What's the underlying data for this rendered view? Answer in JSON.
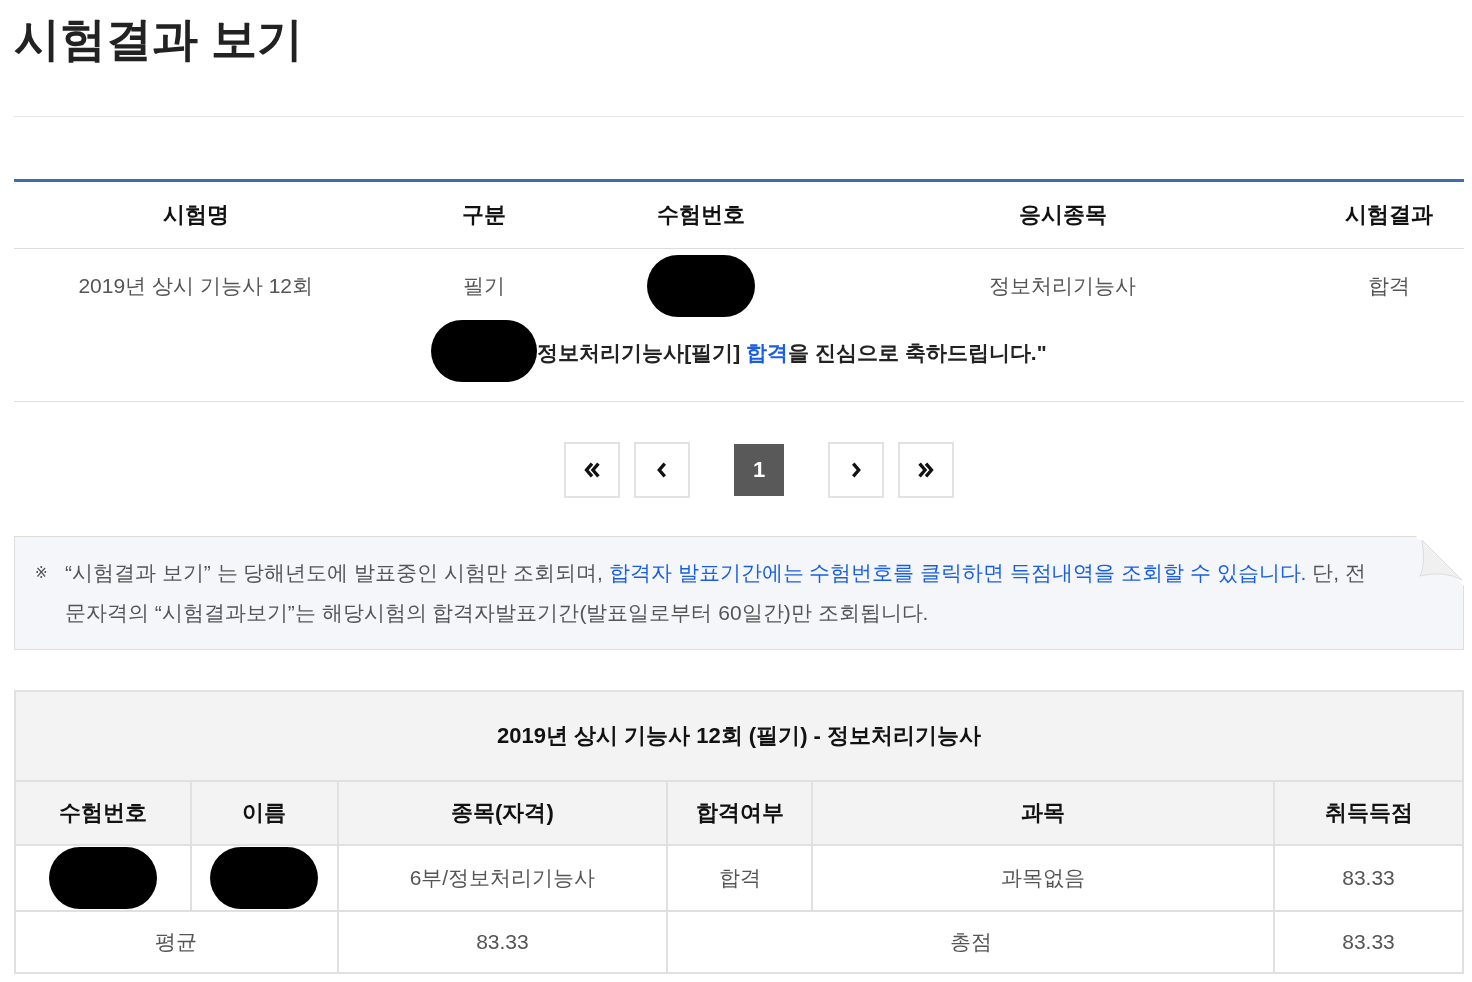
{
  "page_title": "시험결과 보기",
  "results_table": {
    "columns": [
      "시험명",
      "구분",
      "수험번호",
      "응시종목",
      "시험결과"
    ],
    "rows": [
      {
        "cells": [
          {
            "text": "2019년 상시 기능사 12회"
          },
          {
            "text": "필기"
          },
          {
            "redacted": true
          },
          {
            "text": "정보처리기능사"
          },
          {
            "text": "합격"
          }
        ]
      }
    ],
    "congrats": {
      "redacted": true,
      "parts": [
        {
          "text": "정보처리기능사[필기] ",
          "highlight": false
        },
        {
          "text": "합격",
          "highlight": true
        },
        {
          "text": "을 진심으로 축하드립니다.\"",
          "highlight": false
        }
      ]
    }
  },
  "pagination": [
    {
      "kind": "first"
    },
    {
      "kind": "prev"
    },
    {
      "kind": "page",
      "label": "1",
      "selected": true
    },
    {
      "kind": "next"
    },
    {
      "kind": "last"
    }
  ],
  "notice": {
    "marker": "※",
    "parts": [
      {
        "text": "“시험결과 보기” 는 당해년도에 발표중인 시험만 조회되며, ",
        "highlight": false
      },
      {
        "text": "합격자 발표기간에는 수험번호를 클릭하면 득점내역을 조회할 수 있습니다.",
        "highlight": true
      },
      {
        "text": " 단, 전문자격의 “시험결과보기”는 해당시험의 합격자발표기간(발표일로부터 60일간)만 조회됩니다.",
        "highlight": false
      }
    ]
  },
  "score_table": {
    "caption": "2019년 상시 기능사 12회 (필기) - 정보처리기능사",
    "columns": [
      "수험번호",
      "이름",
      "종목(자격)",
      "합격여부",
      "과목",
      "취득득점"
    ],
    "rows": [
      {
        "cells": [
          {
            "redacted": true
          },
          {
            "redacted": true
          },
          {
            "text": "6부/정보처리기능사"
          },
          {
            "text": "합격"
          },
          {
            "text": "과목없음"
          },
          {
            "text": "83.33"
          }
        ]
      }
    ],
    "footer": [
      {
        "label": "평균",
        "value": "83.33"
      },
      {
        "label": "총점",
        "value": "83.33"
      }
    ]
  }
}
